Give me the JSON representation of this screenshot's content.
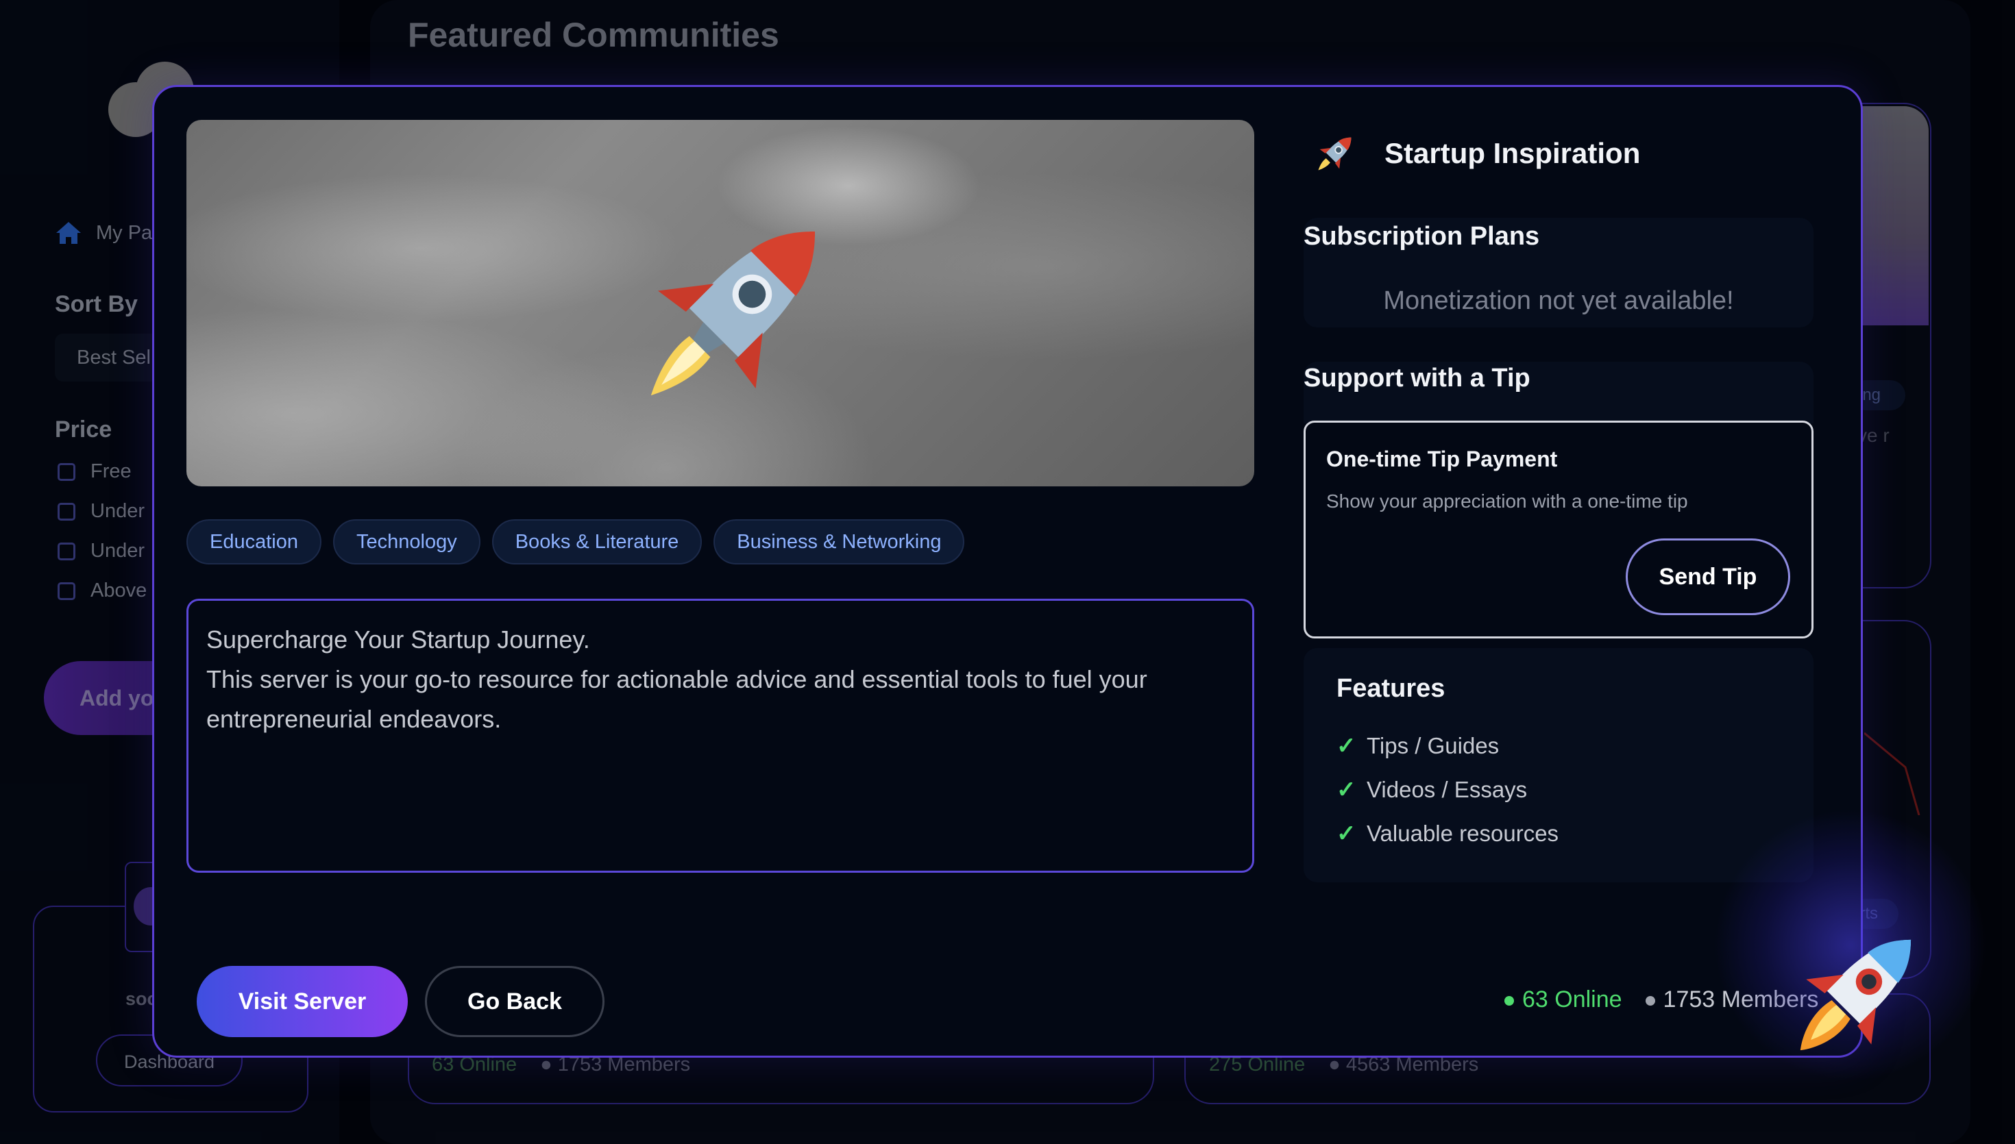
{
  "background": {
    "featured_title": "Featured Communities",
    "sidebar": {
      "my_page_label": "My Pa",
      "sort_by_label": "Sort By",
      "sort_value": "Best Sel",
      "price_label": "Price",
      "price_options": [
        "Free",
        "Under",
        "Under",
        "Above"
      ],
      "add_button_label": "Add yo",
      "profile_name": "soc",
      "dashboard_label": "Dashboard"
    },
    "cards": [
      {
        "online": "63 Online",
        "members": "1753 Members"
      },
      {
        "online": "275 Online",
        "members": "4563 Members"
      }
    ],
    "right_card_tag_1": "king",
    "right_card_tag_2": "orts",
    "right_card_text": "ve r"
  },
  "modal": {
    "community_name": "Startup Inspiration",
    "tags": [
      "Education",
      "Technology",
      "Books & Literature",
      "Business & Networking"
    ],
    "description_line1": "Supercharge Your Startup Journey.",
    "description_line2": "This server is your go-to resource for actionable advice and essential tools to fuel your entrepreneurial endeavors.",
    "subscription_title": "Subscription Plans",
    "subscription_message": "Monetization not yet available!",
    "tip_section_title": "Support with a Tip",
    "tip_card_title": "One-time Tip Payment",
    "tip_card_subtitle": "Show your appreciation with a one-time tip",
    "tip_button": "Send Tip",
    "features_title": "Features",
    "features": [
      "Tips / Guides",
      "Videos / Essays",
      "Valuable resources"
    ],
    "visit_button": "Visit Server",
    "back_button": "Go Back",
    "online": "63 Online",
    "members": "1753 Members"
  },
  "colors": {
    "accent_purple": "#5b3fd4",
    "online_green": "#4fdc6e",
    "tag_text": "#8eb2ff",
    "background": "#03060f"
  },
  "icons": {
    "community": "rocket-icon",
    "home": "home-icon",
    "feature_check": "check-icon"
  }
}
